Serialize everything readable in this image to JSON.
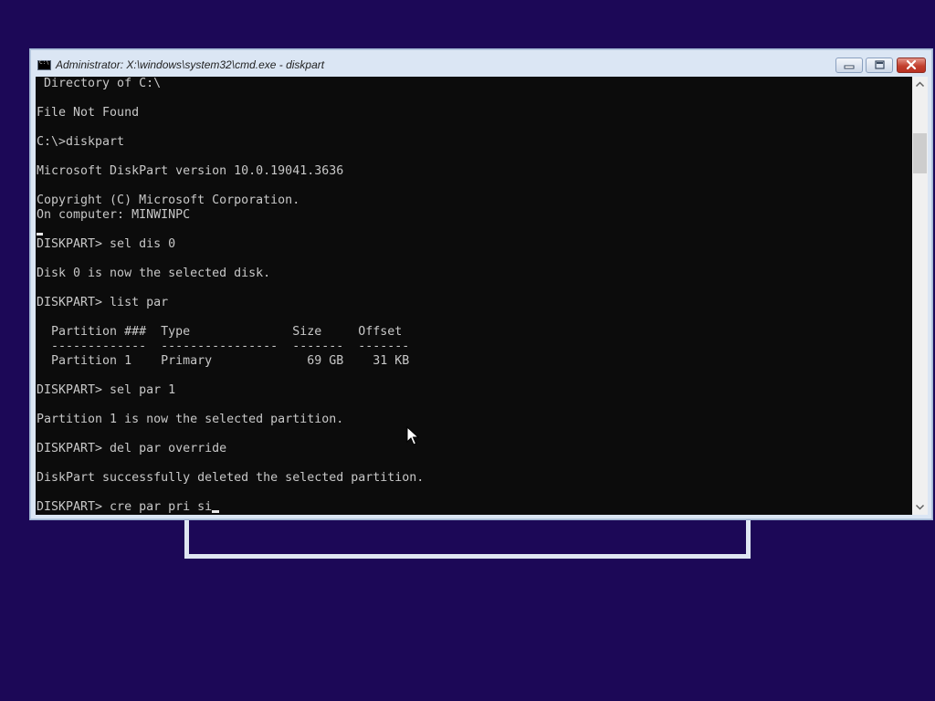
{
  "window": {
    "title": "Administrator: X:\\windows\\system32\\cmd.exe - diskpart",
    "icon": "cmd-icon",
    "buttons": {
      "minimize": "minimize-icon",
      "maximize": "maximize-icon",
      "close": "close-icon"
    }
  },
  "console": {
    "lines": [
      " Directory of C:\\",
      "",
      "File Not Found",
      "",
      "C:\\>diskpart",
      "",
      "Microsoft DiskPart version 10.0.19041.3636",
      "",
      "Copyright (C) Microsoft Corporation.",
      "On computer: MINWINPC",
      "",
      "DISKPART> sel dis 0",
      "",
      "Disk 0 is now the selected disk.",
      "",
      "DISKPART> list par",
      "",
      "  Partition ###  Type              Size     Offset",
      "  -------------  ----------------  -------  -------",
      "  Partition 1    Primary             69 GB    31 KB",
      "",
      "DISKPART> sel par 1",
      "",
      "Partition 1 is now the selected partition.",
      "",
      "DISKPART> del par override",
      "",
      "DiskPart successfully deleted the selected partition.",
      "",
      "DISKPART> cre par pri si"
    ],
    "colors": {
      "background": "#0c0c0c",
      "text": "#c8c8c8"
    }
  },
  "desktop": {
    "background": "#1c0857"
  },
  "pointer": "arrow-pointer-icon"
}
